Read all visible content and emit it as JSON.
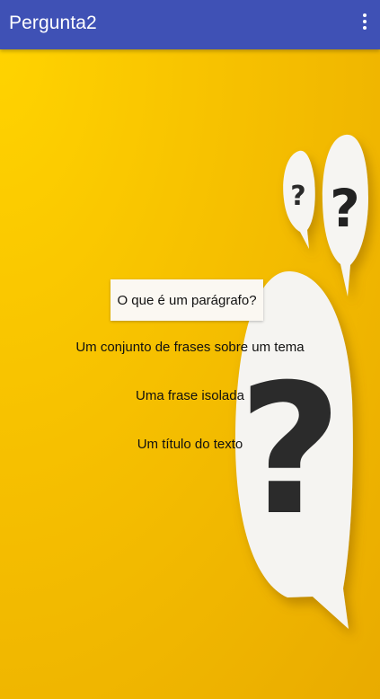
{
  "app_bar": {
    "title": "Pergunta2",
    "menu_icon": "more-vert-icon"
  },
  "quiz": {
    "question": "O que é um parágrafo?",
    "answers": [
      "Um conjunto de frases sobre um tema",
      "Uma frase isolada",
      "Um título do texto"
    ]
  },
  "colors": {
    "app_bar": "#3f51b5",
    "background": "#f6c000",
    "bubble": "#f5f4f1"
  }
}
